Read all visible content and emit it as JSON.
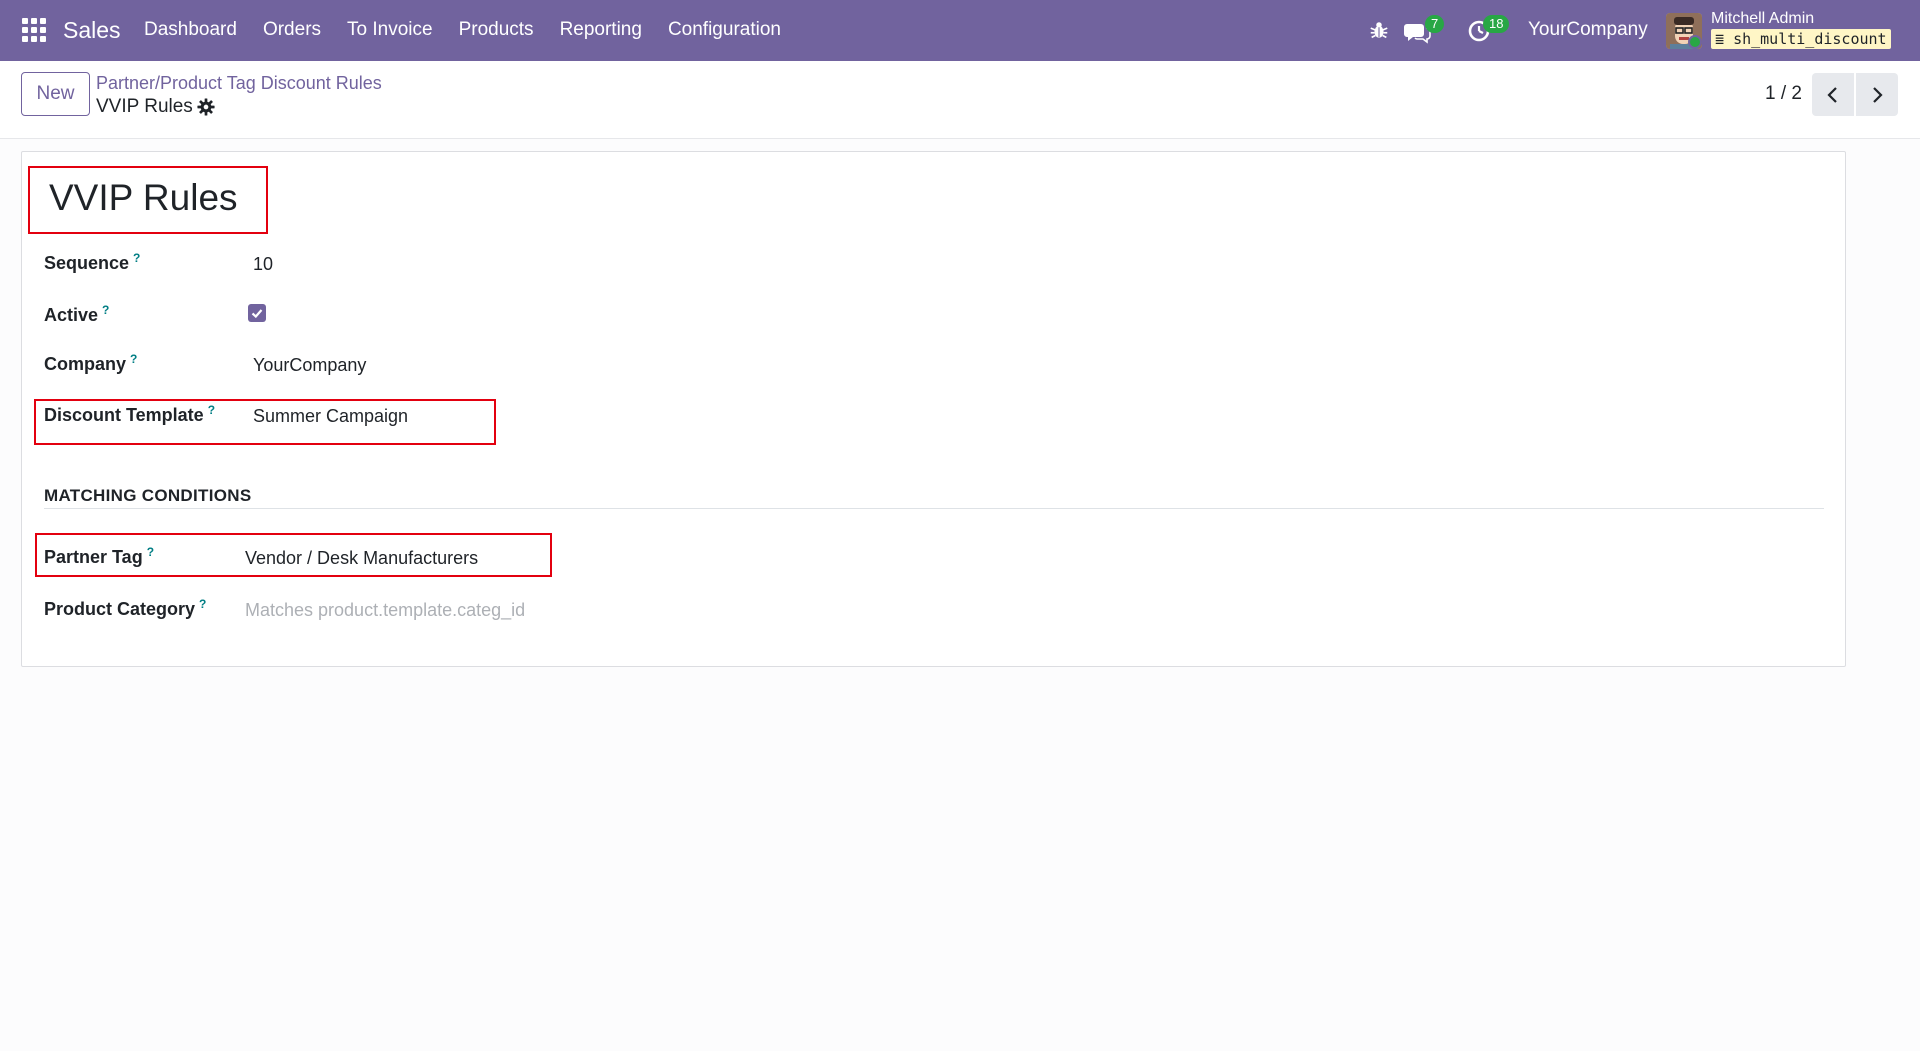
{
  "navbar": {
    "app_name": "Sales",
    "menu": [
      "Dashboard",
      "Orders",
      "To Invoice",
      "Products",
      "Reporting",
      "Configuration"
    ],
    "messages_count": "7",
    "activities_count": "18",
    "company": "YourCompany",
    "user_name": "Mitchell Admin",
    "database": "sh_multi_discount",
    "color": "#71639e"
  },
  "control_panel": {
    "new_label": "New",
    "breadcrumb": "Partner/Product Tag Discount Rules",
    "record_title": "VVIP Rules",
    "pager": "1 / 2"
  },
  "form": {
    "name": "VVIP Rules",
    "fields": {
      "sequence": {
        "label": "Sequence",
        "value": "10"
      },
      "active": {
        "label": "Active",
        "checked": true
      },
      "company": {
        "label": "Company",
        "value": "YourCompany"
      },
      "discount_template": {
        "label": "Discount Template",
        "value": "Summer Campaign"
      }
    },
    "section_title": "MATCHING CONDITIONS",
    "conditions": {
      "partner_tag": {
        "label": "Partner Tag",
        "value": "Vendor / Desk Manufacturers"
      },
      "product_category": {
        "label": "Product Category",
        "placeholder": "Matches product.template.categ_id"
      }
    },
    "help_mark": "?"
  },
  "colors": {
    "highlight": "#e3000f",
    "help": "#017e84"
  },
  "icons": [
    "apps-icon",
    "bug-icon",
    "chat-icon",
    "activity-clock-icon",
    "gear-icon",
    "chevron-left-icon",
    "chevron-right-icon",
    "check-icon"
  ]
}
